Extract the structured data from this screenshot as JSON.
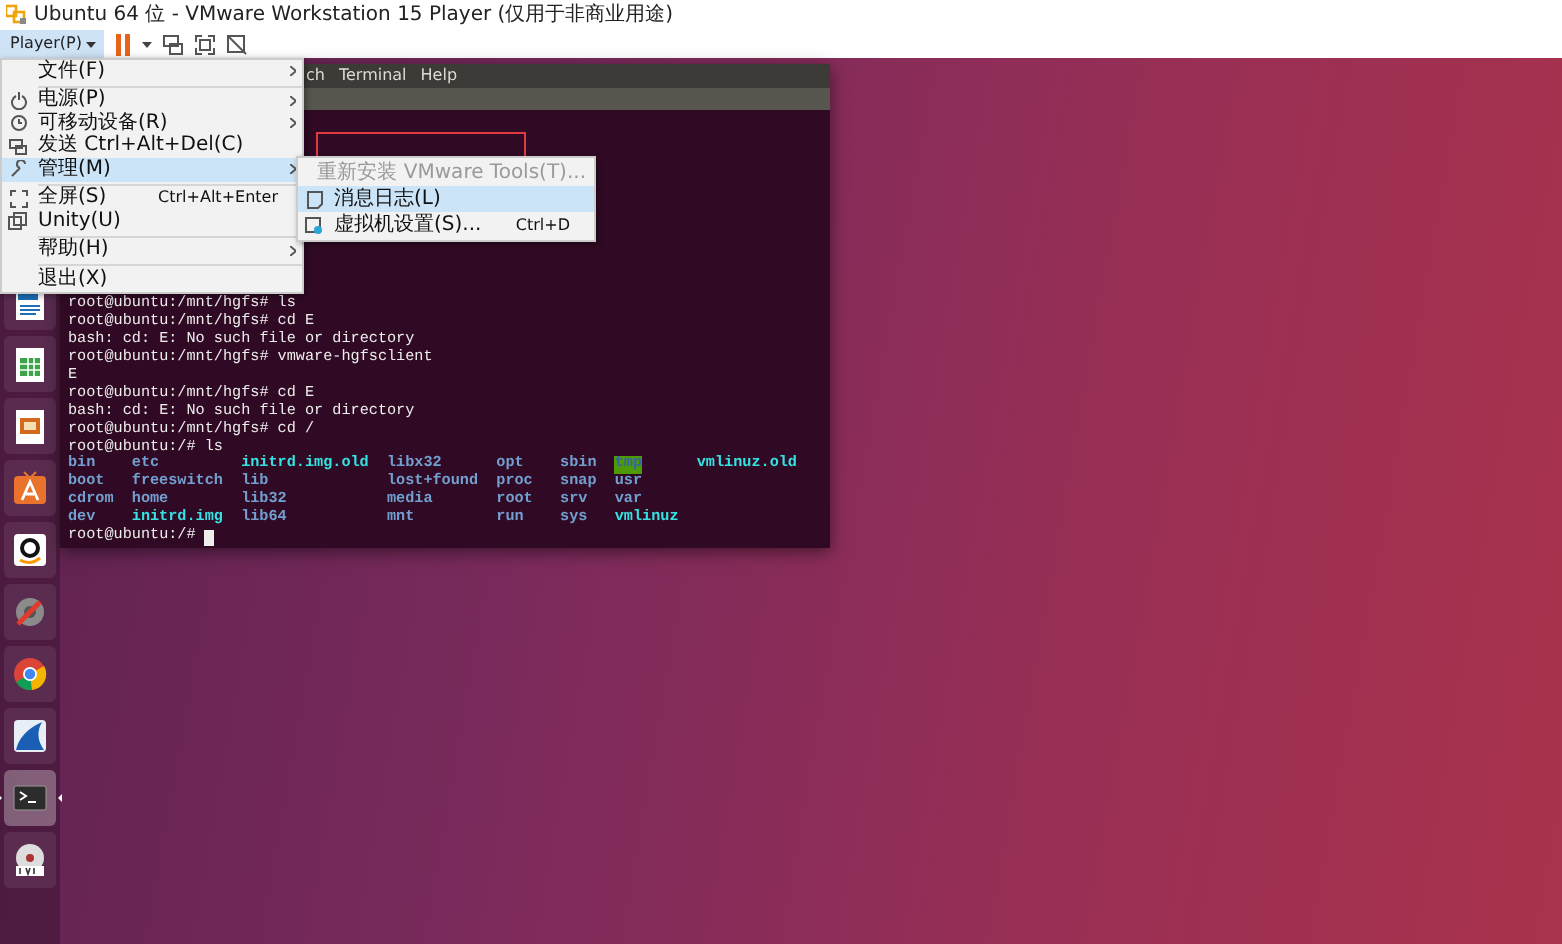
{
  "window": {
    "title": "Ubuntu 64 位 - VMware Workstation 15 Player (仅用于非商业用途)"
  },
  "toolbar": {
    "player_button": "Player(P)"
  },
  "player_menu": {
    "items": [
      {
        "kind": "plain",
        "label": "文件(F)",
        "submenu": true,
        "selected": false
      },
      {
        "kind": "separator"
      },
      {
        "kind": "power",
        "label": "电源(P)",
        "submenu": true,
        "selected": false
      },
      {
        "kind": "device",
        "label": "可移动设备(R)",
        "submenu": true,
        "selected": false
      },
      {
        "kind": "send",
        "label": "发送 Ctrl+Alt+Del(C)",
        "submenu": false,
        "selected": false
      },
      {
        "kind": "wrench",
        "label": "管理(M)",
        "submenu": true,
        "selected": true
      },
      {
        "kind": "separator"
      },
      {
        "kind": "fullscreen",
        "label": "全屏(S)",
        "shortcut": "Ctrl+Alt+Enter",
        "submenu": false,
        "selected": false
      },
      {
        "kind": "unity",
        "label": "Unity(U)",
        "submenu": false,
        "selected": false
      },
      {
        "kind": "separator"
      },
      {
        "kind": "plain",
        "label": "帮助(H)",
        "submenu": true,
        "selected": false
      },
      {
        "kind": "separator"
      },
      {
        "kind": "plain",
        "label": "退出(X)",
        "submenu": false,
        "selected": false
      }
    ]
  },
  "manage_submenu": {
    "items": [
      {
        "kind": "plain",
        "label": "重新安装 VMware Tools(T)...",
        "disabled": true,
        "selected": false
      },
      {
        "kind": "log",
        "label": "消息日志(L)",
        "disabled": false,
        "selected": true
      },
      {
        "kind": "settings",
        "label": "虚拟机设置(S)...",
        "shortcut": "Ctrl+D",
        "disabled": false,
        "selected": false
      }
    ]
  },
  "dock": [
    {
      "kind": "writer",
      "active": false
    },
    {
      "kind": "calc",
      "active": false
    },
    {
      "kind": "impress",
      "active": false
    },
    {
      "kind": "store",
      "active": false
    },
    {
      "kind": "amazon",
      "active": false
    },
    {
      "kind": "settings",
      "active": false
    },
    {
      "kind": "chrome",
      "active": false
    },
    {
      "kind": "wireshark",
      "active": false
    },
    {
      "kind": "terminal",
      "active": true
    },
    {
      "kind": "dvd",
      "active": false
    }
  ],
  "terminal": {
    "menu": [
      "ch",
      "Terminal",
      "Help"
    ],
    "lines": [
      "root@ubuntu:/mnt/hgfs# ls",
      "root@ubuntu:/mnt/hgfs# cd E",
      "bash: cd: E: No such file or directory",
      "root@ubuntu:/mnt/hgfs# vmware-hgfsclient",
      "E",
      "root@ubuntu:/mnt/hgfs# cd E",
      "bash: cd: E: No such file or directory",
      "root@ubuntu:/mnt/hgfs# cd /",
      "root@ubuntu:/# ls"
    ],
    "listing": [
      [
        {
          "name": "bin",
          "kind": "dir"
        },
        {
          "name": "etc",
          "kind": "dir"
        },
        {
          "name": "initrd.img.old",
          "kind": "link"
        },
        {
          "name": "libx32",
          "kind": "dir"
        },
        {
          "name": "opt",
          "kind": "dir"
        },
        {
          "name": "sbin",
          "kind": "dir"
        },
        {
          "name": "tmp",
          "kind": "sticky"
        },
        {
          "name": "vmlinuz.old",
          "kind": "link"
        }
      ],
      [
        {
          "name": "boot",
          "kind": "dir"
        },
        {
          "name": "freeswitch",
          "kind": "dir"
        },
        {
          "name": "lib",
          "kind": "dir"
        },
        {
          "name": "lost+found",
          "kind": "dir"
        },
        {
          "name": "proc",
          "kind": "dir"
        },
        {
          "name": "snap",
          "kind": "dir"
        },
        {
          "name": "usr",
          "kind": "dir"
        }
      ],
      [
        {
          "name": "cdrom",
          "kind": "dir"
        },
        {
          "name": "home",
          "kind": "dir"
        },
        {
          "name": "lib32",
          "kind": "dir"
        },
        {
          "name": "media",
          "kind": "dir"
        },
        {
          "name": "root",
          "kind": "dir"
        },
        {
          "name": "srv",
          "kind": "dir"
        },
        {
          "name": "var",
          "kind": "dir"
        }
      ],
      [
        {
          "name": "dev",
          "kind": "dir"
        },
        {
          "name": "initrd.img",
          "kind": "link"
        },
        {
          "name": "lib64",
          "kind": "dir"
        },
        {
          "name": "mnt",
          "kind": "dir"
        },
        {
          "name": "run",
          "kind": "dir"
        },
        {
          "name": "sys",
          "kind": "dir"
        },
        {
          "name": "vmlinuz",
          "kind": "link"
        }
      ]
    ],
    "prompt": "root@ubuntu:/#"
  }
}
